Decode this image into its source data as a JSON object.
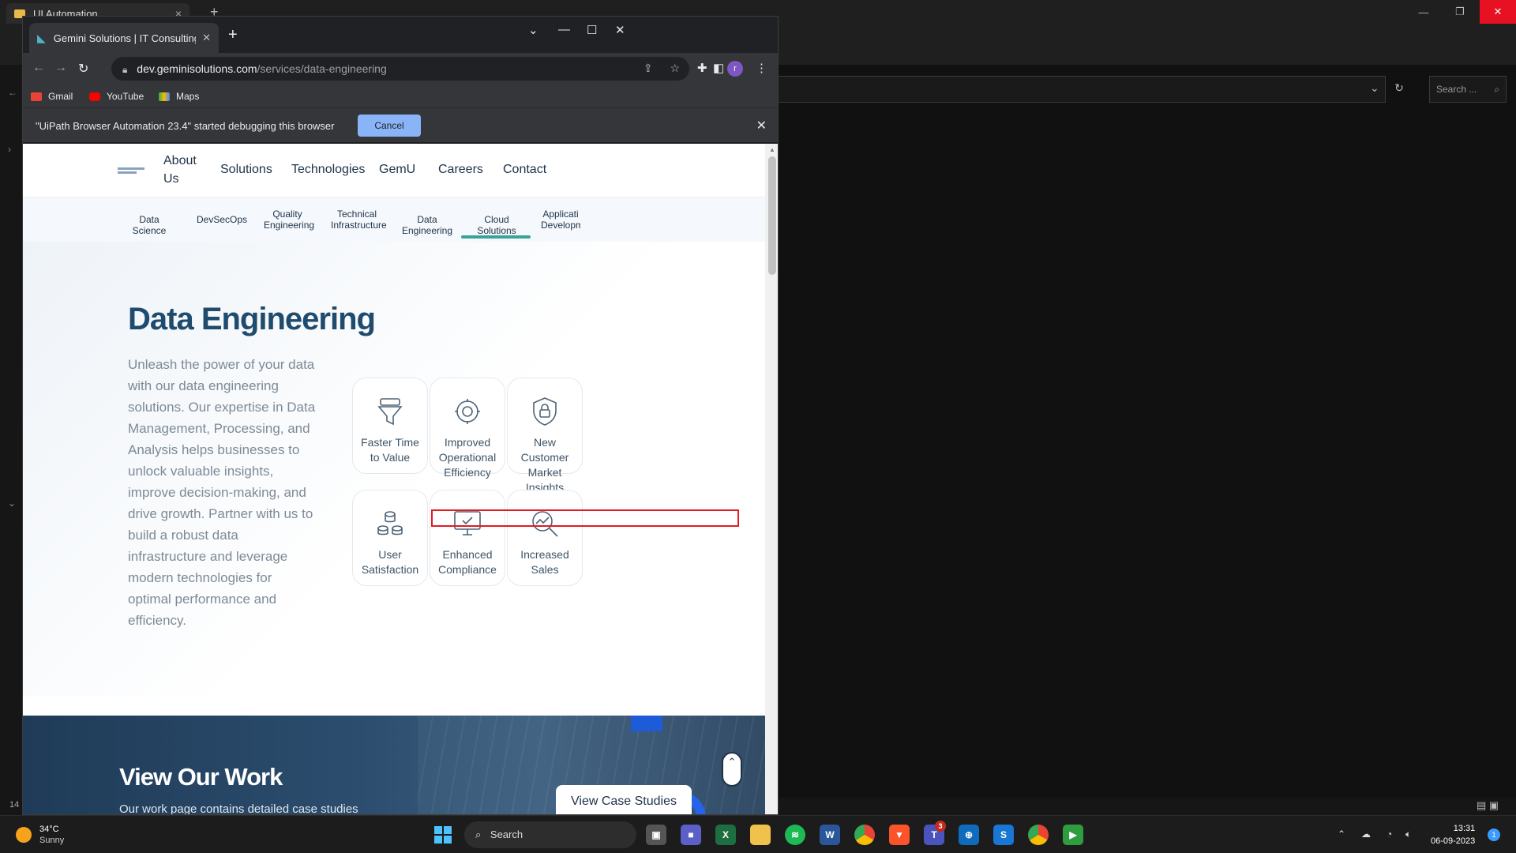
{
  "background_app": {
    "tab_title": "UI Automation",
    "search_placeholder": "Search ...",
    "status_line_number": "14"
  },
  "browser": {
    "tab_title": "Gemini Solutions | IT Consulting,",
    "url_host": "dev.geminisolutions.com",
    "url_path": "/services/data-engineering",
    "profile_initial": "r",
    "bookmarks": [
      "Gmail",
      "YouTube",
      "Maps"
    ],
    "infobar_message": "\"UiPath Browser Automation 23.4\" started debugging this browser",
    "infobar_cancel": "Cancel"
  },
  "site": {
    "nav": [
      "About Us",
      "Solutions",
      "Technologies",
      "GemU",
      "Careers",
      "Contact"
    ],
    "subnav": [
      "Data Science",
      "DevSecOps",
      "Quality Engineering",
      "Technical Infrastructure",
      "Data Engineering",
      "Cloud Solutions",
      "Applicati Developm"
    ],
    "active_subnav": "Data Engineering",
    "hero": {
      "title": "Data Engineering",
      "description": "Unleash the power of your data with our data engineering solutions. Our expertise in Data Management, Processing, and Analysis helps businesses to unlock valuable insights, improve decision-making, and drive growth. Partner with us to build a robust data infrastructure and leverage modern technologies for optimal performance and efficiency."
    },
    "benefits": [
      {
        "label": "Faster Time to Value",
        "icon": "funnel-icon"
      },
      {
        "label": "Improved Operational Efficiency",
        "icon": "gear-icon"
      },
      {
        "label": "New Customer Market Insights",
        "icon": "shield-lock-icon"
      },
      {
        "label": "User Satisfaction",
        "icon": "database-icon"
      },
      {
        "label": "Enhanced Compliance",
        "icon": "monitor-check-icon"
      },
      {
        "label": "Increased Sales",
        "icon": "analytics-search-icon"
      }
    ],
    "work": {
      "title": "View Our Work",
      "subtitle": "Our work page contains detailed case studies",
      "button": "View Case Studies"
    }
  },
  "taskbar": {
    "temperature": "34°C",
    "weather": "Sunny",
    "search": "Search",
    "time": "13:31",
    "date": "06-09-2023",
    "teams_badge": "3",
    "notifications": "1"
  },
  "colors": {
    "accent_teal": "#3aa39a",
    "title_blue": "#1f4b6e",
    "infobar_button": "#8ab4f8",
    "highlight_red": "#e01b22"
  }
}
